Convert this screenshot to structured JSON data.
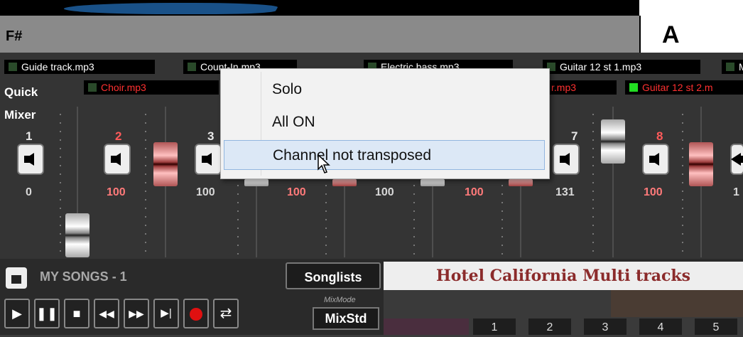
{
  "chord_row": {
    "left_chord": "F#",
    "right_chord": "A"
  },
  "tracks_row1": [
    {
      "label": "Guide track.mp3",
      "color": "white"
    },
    {
      "label": "Count-In.mp3",
      "color": "white"
    },
    {
      "label": "Electric bass.mp3",
      "color": "white"
    },
    {
      "label": "Guitar 12 st 1.mp3",
      "color": "white"
    },
    {
      "label": "M",
      "color": "white"
    }
  ],
  "tracks_row2": [
    {
      "label": "Choir.mp3",
      "color": "red"
    },
    {
      "label": "r.mp3",
      "color": "red"
    },
    {
      "label": "Guitar 12 st 2.m",
      "color": "red"
    }
  ],
  "quick_mixer": {
    "line1": "Quick",
    "line2": "Mixer"
  },
  "channels": [
    {
      "number": "1",
      "volume": "0",
      "color": "white"
    },
    {
      "number": "2",
      "volume": "100",
      "color": "red"
    },
    {
      "number": "3",
      "volume": "100",
      "color": "white"
    },
    {
      "number": "",
      "volume": "100",
      "color": "red"
    },
    {
      "number": "",
      "volume": "100",
      "color": "white"
    },
    {
      "number": "",
      "volume": "100",
      "color": "red"
    },
    {
      "number": "7",
      "volume": "131",
      "color": "white"
    },
    {
      "number": "8",
      "volume": "100",
      "color": "red"
    },
    {
      "number": "",
      "volume": "1",
      "color": "white"
    }
  ],
  "context_menu": {
    "items": [
      "Solo",
      "All ON",
      "Channel not transposed"
    ],
    "highlighted": "Channel not transposed"
  },
  "songs": {
    "section_label": "MY SONGS - 1",
    "songlists_button": "Songlists",
    "current_song": "Hotel California Multi tracks"
  },
  "transport": {
    "buttons": [
      "play-icon",
      "pause-icon",
      "stop-icon",
      "rewind-icon",
      "fast-forward-icon",
      "skip-end-icon",
      "record-icon",
      "swap-icon"
    ],
    "mixmode_label": "MixMode",
    "mixmode_value": "MixStd"
  },
  "pattern_numbers": [
    "1",
    "2",
    "3",
    "4",
    "5"
  ],
  "colors": {
    "track_red": "#ff3030",
    "song_title": "#8b2b2b",
    "menu_highlight": "#dce8f6"
  }
}
